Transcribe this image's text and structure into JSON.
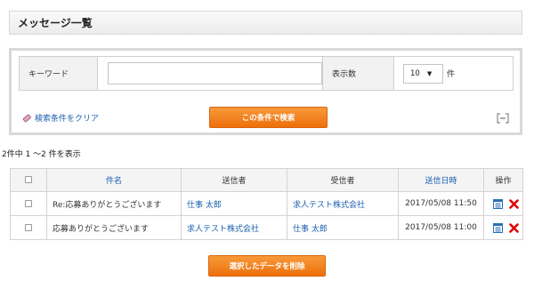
{
  "header": {
    "title": "メッセージ一覧"
  },
  "search": {
    "keyword_label": "キーワード",
    "keyword_value": "",
    "count_label": "表示数",
    "count_value": "10",
    "count_unit": "件",
    "clear_label": "検索条件をクリア",
    "submit_label": "この条件で検索",
    "collapse_icon": "collapse-icon"
  },
  "results": {
    "summary": "2件中 1 〜2 件を表示",
    "columns": [
      "件名",
      "送信者",
      "受信者",
      "送信日時",
      "操作"
    ],
    "rows": [
      {
        "subject": "Re:応募ありがとうございます",
        "sender": "仕事 太郎",
        "receiver": "求人テスト株式会社",
        "sent_at": "2017/05/08 11:50"
      },
      {
        "subject": "応募ありがとうございます",
        "sender": "求人テスト株式会社",
        "receiver": "仕事 太郎",
        "sent_at": "2017/05/08 11:00"
      }
    ],
    "delete_label": "選択したデータを削除"
  },
  "colors": {
    "accent": "#ee6f0b",
    "link": "#1b5fad",
    "delete": "#e00000",
    "view": "#2a6fb5"
  }
}
